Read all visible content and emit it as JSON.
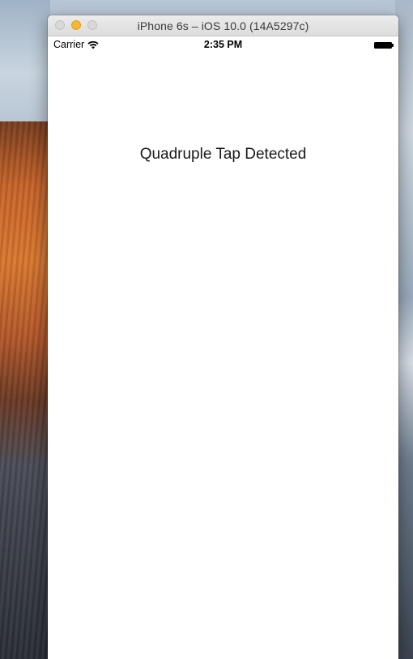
{
  "window": {
    "title": "iPhone 6s – iOS 10.0 (14A5297c)"
  },
  "traffic_lights": {
    "close_color": "#d8d8d8",
    "minimize_color": "#f5b82e",
    "zoom_color": "#d8d8d8"
  },
  "status_bar": {
    "carrier": "Carrier",
    "wifi_icon": "wifi-icon",
    "time": "2:35 PM",
    "battery_icon": "battery-icon"
  },
  "main": {
    "message": "Quadruple Tap Detected"
  }
}
